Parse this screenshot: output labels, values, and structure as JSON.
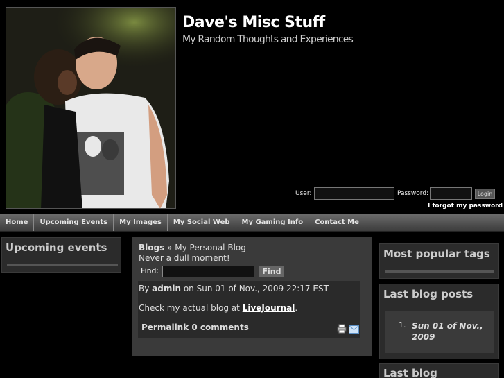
{
  "header": {
    "title": "Dave's Misc Stuff",
    "subtitle": "My Random Thoughts and Experiences"
  },
  "login": {
    "user_label": "User:",
    "password_label": "Password:",
    "login_button": "Login",
    "forgot_link": "I forgot my password"
  },
  "nav": {
    "items": [
      "Home",
      "Upcoming Events",
      "My Images",
      "My Social Web",
      "My Gaming Info",
      "Contact Me"
    ]
  },
  "left": {
    "upcoming_title": "Upcoming events"
  },
  "center": {
    "breadcrumb_root": "Blogs",
    "breadcrumb_sep": " » ",
    "breadcrumb_current": "My Personal Blog",
    "tagline": "Never a dull moment!",
    "find_label": "Find:",
    "find_button": "Find",
    "post": {
      "by": "By ",
      "author": "admin",
      "on": " on Sun 01 of Nov., 2009 22:17 EST",
      "body_prefix": "Check my actual blog at ",
      "body_link": "LiveJournal",
      "body_suffix": ".",
      "permalink": "Permalink",
      "comments": " 0 comments"
    }
  },
  "right": {
    "popular_tags_title": "Most popular tags",
    "last_posts_title": "Last blog posts",
    "last_posts": [
      {
        "num": "1.",
        "date": "Sun 01 of Nov., 2009"
      }
    ],
    "last_blog_title": "Last blog"
  },
  "icons": {
    "print": "print-icon",
    "email": "email-icon"
  }
}
